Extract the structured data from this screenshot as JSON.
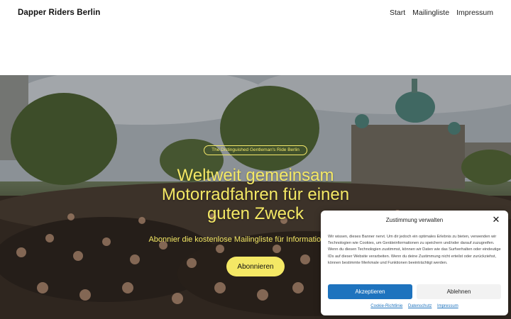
{
  "header": {
    "brand": "Dapper Riders Berlin",
    "nav": [
      {
        "label": "Start"
      },
      {
        "label": "Mailingliste"
      },
      {
        "label": "Impressum"
      }
    ]
  },
  "hero": {
    "badge": "The Distinguished Gentleman's Ride Berlin",
    "title": "Weltweit gemeinsam Motorradfahren für einen guten Zweck",
    "subtitle": "Abonnier die kostenlose Mailingliste für Informationen",
    "cta_label": "Abonnieren",
    "accent_color": "#f4e865"
  },
  "consent": {
    "title": "Zustimmung verwalten",
    "text": "Wir wissen, dieses Banner nervt. Um dir jedoch ein optimales Erlebnis zu bieten, verwenden wir Technologien wie Cookies, um Geräteinformationen zu speichern und/oder darauf zuzugreifen. Wenn du diesen Technologien zustimmst, können wir Daten wie das Surfverhalten oder eindeutige IDs auf dieser Website verarbeiten. Wenn du deine Zustimmung nicht erteilst oder zurückziehst, können bestimmte Merkmale und Funktionen beeinträchtigt werden.",
    "accept_label": "Akzeptieren",
    "deny_label": "Ablehnen",
    "links": [
      {
        "label": "Cookie-Richtlinie"
      },
      {
        "label": "Datenschutz"
      },
      {
        "label": "Impressum"
      }
    ],
    "accept_color": "#1e73be"
  }
}
